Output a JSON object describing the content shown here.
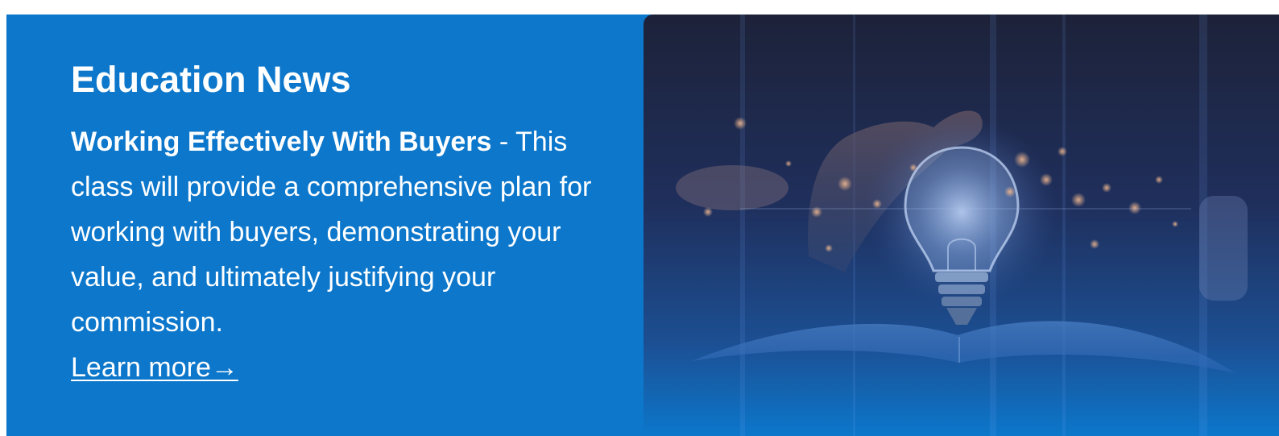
{
  "section": {
    "title": "Education News"
  },
  "article": {
    "class_title": "Working Effectively With Buyers",
    "separator": " - ",
    "description": "This class will provide a comprehensive plan for working with buyers, demonstrating your value, and ultimately justifying your commission.",
    "learn_more_label": "Learn more→"
  },
  "colors": {
    "banner_background": "#0c77cb",
    "text": "#ffffff",
    "image_top": "#1d2239"
  },
  "image": {
    "subject": "hand-touching-glowing-lightbulb-over-open-book"
  }
}
